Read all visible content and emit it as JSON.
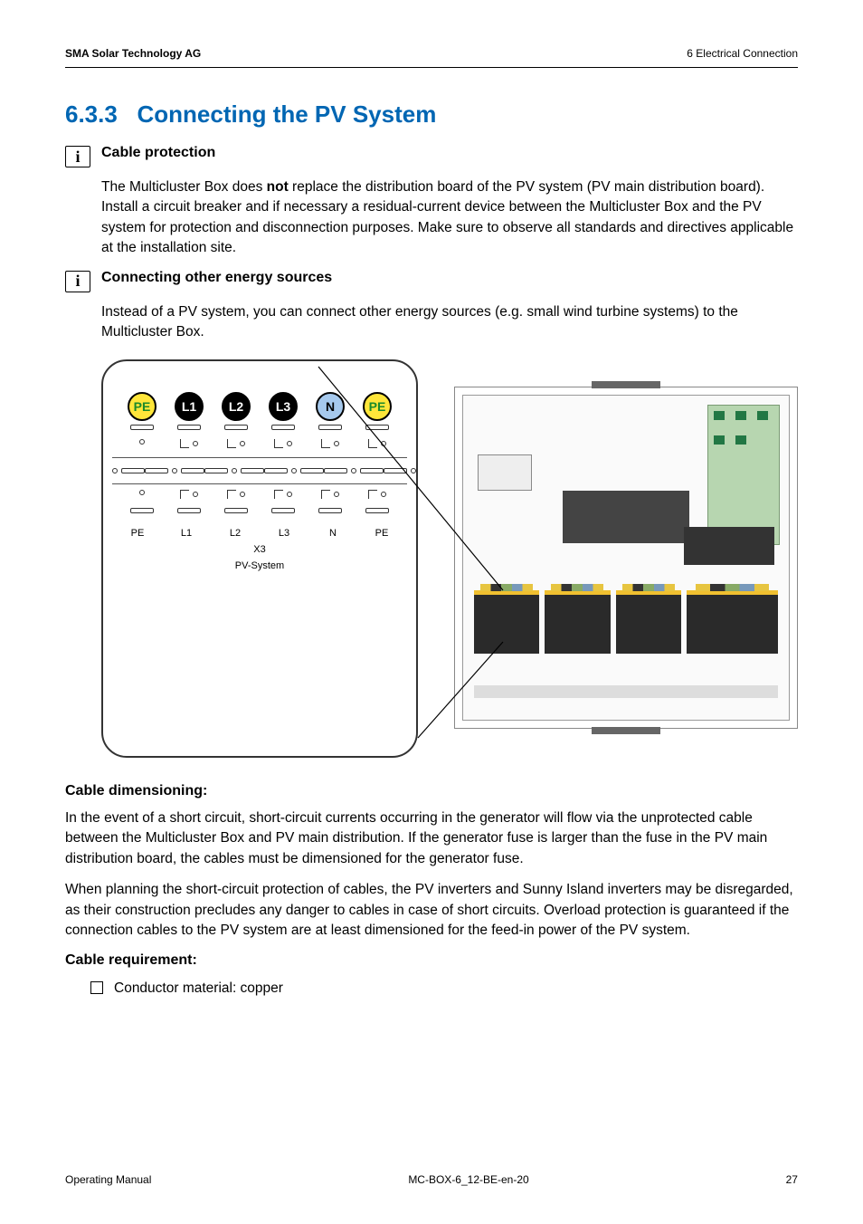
{
  "header": {
    "company": "SMA Solar Technology AG",
    "chapter": "6  Electrical Connection"
  },
  "section": {
    "number": "6.3.3",
    "title": "Connecting the PV System"
  },
  "info_boxes": [
    {
      "title": "Cable protection",
      "body_html": "The Multicluster Box does <b>not</b> replace the distribution board of the PV system (PV main distribution board). Install a circuit breaker and if necessary a residual-current device between the Multicluster Box and the PV system for protection and disconnection purposes. Make sure to observe all standards and directives applicable at the installation site."
    },
    {
      "title": "Connecting other energy sources",
      "body": "Instead of a PV system, you can connect other energy sources (e.g. small wind turbine systems) to the Multicluster Box."
    }
  ],
  "diagram": {
    "terminals": [
      "PE",
      "L1",
      "L2",
      "L3",
      "N",
      "PE"
    ],
    "block_id": "X3",
    "block_name": "PV-System"
  },
  "sections": {
    "dimensioning": {
      "heading": "Cable dimensioning:",
      "p1": "In the event of a short circuit, short-circuit currents occurring in the generator will flow via the unprotected cable between the Multicluster Box and PV main distribution. If the generator fuse is larger than the fuse in the PV main distribution board, the cables must be dimensioned for the generator fuse.",
      "p2": "When planning the short-circuit protection of cables, the PV inverters and Sunny Island inverters may be disregarded, as their construction precludes any danger to cables in case of short circuits. Overload protection is guaranteed if the connection cables to the PV system are at least dimensioned for the feed-in power of the PV system."
    },
    "requirement": {
      "heading": "Cable requirement:",
      "items": [
        "Conductor material: copper"
      ]
    }
  },
  "footer": {
    "left": "Operating Manual",
    "center": "MC-BOX-6_12-BE-en-20",
    "right": "27"
  }
}
